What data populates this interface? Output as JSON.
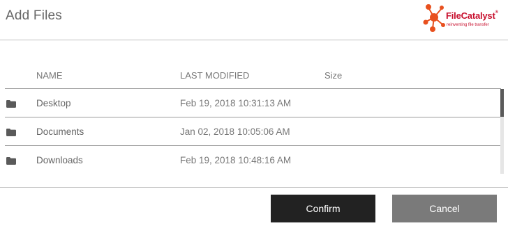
{
  "dialog": {
    "title": "Add Files"
  },
  "logo": {
    "name": "FileCatalyst",
    "registered": "®",
    "tagline": "reinventing file transfer",
    "brand_color": "#c8102e",
    "mark_color": "#e8501e"
  },
  "table": {
    "columns": {
      "name": "NAME",
      "modified": "LAST MODIFIED",
      "size": "Size"
    },
    "rows": [
      {
        "icon": "folder-icon",
        "name": "Desktop",
        "modified": "Feb 19, 2018 10:31:13 AM",
        "size": ""
      },
      {
        "icon": "folder-icon",
        "name": "Documents",
        "modified": "Jan 02, 2018 10:05:06 AM",
        "size": ""
      },
      {
        "icon": "folder-icon",
        "name": "Downloads",
        "modified": "Feb 19, 2018 10:48:16 AM",
        "size": ""
      }
    ]
  },
  "buttons": {
    "confirm": "Confirm",
    "cancel": "Cancel"
  },
  "colors": {
    "confirm_bg": "#222222",
    "cancel_bg": "#7a7a7a",
    "divider": "#999999"
  }
}
